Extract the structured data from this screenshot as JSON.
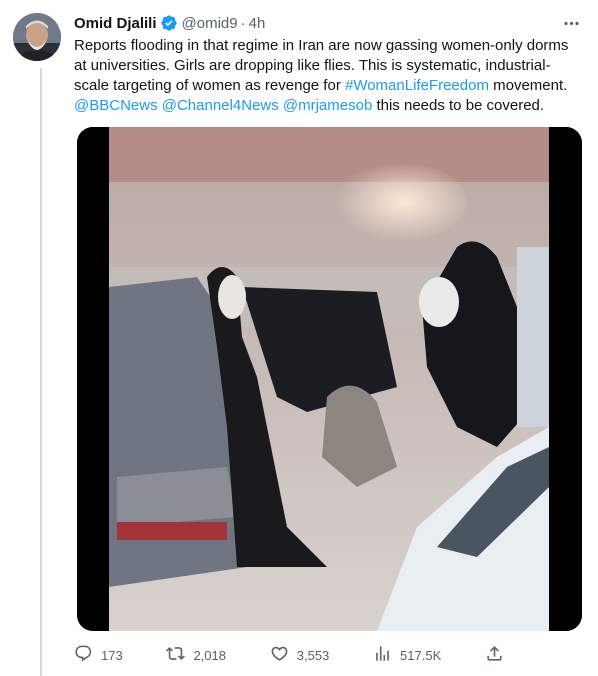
{
  "tweet": {
    "author_name": "Omid Djalili",
    "author_handle": "@omid9",
    "separator": "·",
    "timestamp": "4h",
    "text_part1": "Reports flooding in that regime in Iran are now gassing women-only dorms at universities. Girls are dropping like flies. This is systematic, industrial-scale targeting of women as revenge for ",
    "hashtag": "#WomanLifeFreedom",
    "text_part2": " movement.",
    "mention1": "@BBCNews",
    "mention2": "@Channel4News",
    "mention3": "@mrjamesob",
    "text_part3": " this needs to be covered."
  },
  "metrics": {
    "replies": "173",
    "retweets": "2,018",
    "likes": "3,553",
    "views": "517.5K"
  },
  "icons": {
    "verified": "verified-badge-icon",
    "more": "more-icon",
    "reply": "reply-icon",
    "retweet": "retweet-icon",
    "like": "heart-icon",
    "views": "views-chart-icon",
    "share": "share-icon"
  },
  "colors": {
    "link": "#1d9bf0",
    "secondary_text": "#536471",
    "primary_text": "#0f1419"
  }
}
